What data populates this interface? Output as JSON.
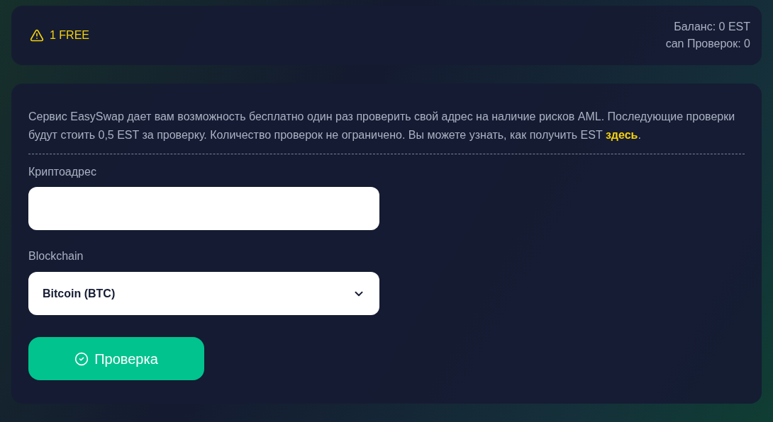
{
  "status": {
    "free_label": "1 FREE",
    "balance": "Баланс: 0 EST",
    "checks": "can Проверок: 0"
  },
  "intro": {
    "text": "Сервис EasySwap дает вам возможность бесплатно один раз проверить свой адрес на наличие рисков AML. Последующие проверки будут стоить 0,5 EST за проверку. Количество проверок не ограничено. Вы можете узнать, как получить EST ",
    "link": "здесь",
    "end": "."
  },
  "form": {
    "address_label": "Криптоадрес",
    "blockchain_label": "Blockchain",
    "blockchain_value": "Bitcoin (BTC)",
    "submit": "Проверка"
  }
}
